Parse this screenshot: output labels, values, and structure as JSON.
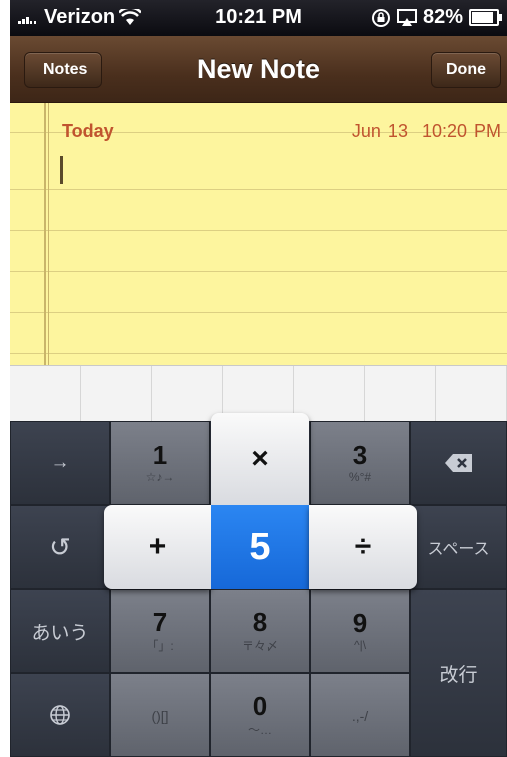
{
  "status_bar": {
    "carrier": "Verizon",
    "time": "10:21 PM",
    "battery": "82%",
    "battery_level": 0.82
  },
  "nav": {
    "back_label": "Notes",
    "title": "New Note",
    "done_label": "Done"
  },
  "note": {
    "today_label": "Today",
    "date": "Jun 13",
    "time": "10:20 PM"
  },
  "keyboard": {
    "left": {
      "arrow": "→",
      "undo": "↺",
      "kana": "あいう",
      "globe": "globe"
    },
    "keys": {
      "k1": {
        "main": "1",
        "sub": "☆♪→"
      },
      "k3": {
        "main": "3",
        "sub": "%°#"
      },
      "k7": {
        "main": "7",
        "sub": "「」:"
      },
      "k8": {
        "main": "8",
        "sub": "〒々〆"
      },
      "k9": {
        "main": "9",
        "sub": "^|\\"
      },
      "k0": {
        "main": "0",
        "sub": "〜…"
      },
      "kb": {
        "main": "()[]"
      },
      "kp": {
        "main": ".,-/"
      }
    },
    "flick": {
      "up": "×",
      "left": "+",
      "center": "5",
      "right": "÷"
    },
    "right": {
      "space": "スペース",
      "enter": "改行"
    },
    "colors": {
      "accent": "#1f76e6",
      "paper": "#fdf59e",
      "date_text": "#c0542f"
    }
  }
}
